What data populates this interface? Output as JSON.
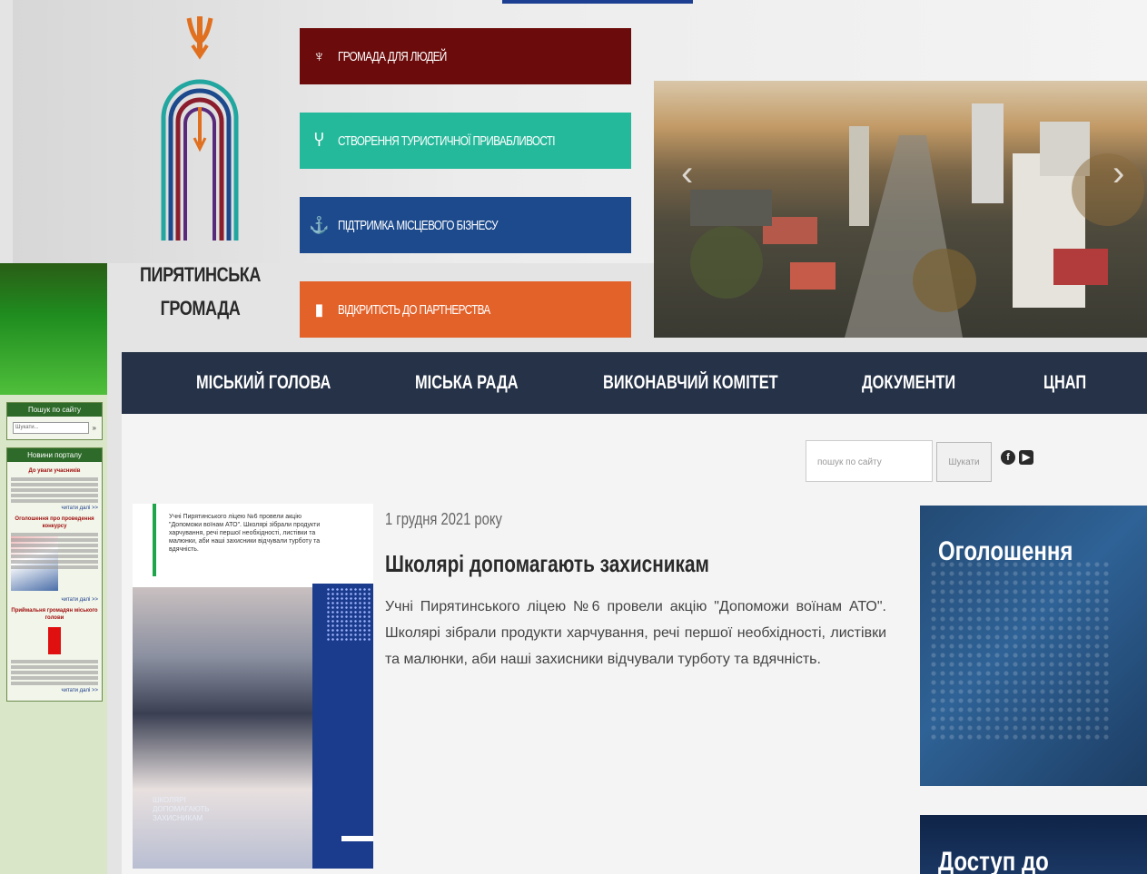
{
  "old_site": {
    "search_title": "Пошук по сайту",
    "search_placeholder": "Шукати...",
    "search_go": "»",
    "news_title": "Новини порталу",
    "news_items": [
      {
        "headline": "До уваги учасників",
        "more": "читати далі >>"
      },
      {
        "headline": "Оголошення про проведення конкурсу",
        "more": "читати далі >>"
      },
      {
        "headline": "Приймальня громадян міського голови",
        "more": "читати далі >>"
      }
    ]
  },
  "logo": {
    "line1": "ПИРЯТИНСЬКА",
    "line2": "ГРОМАДА"
  },
  "priorities": [
    {
      "label": "ГРОМАДА ДЛЯ ЛЮДЕЙ",
      "color": "#6b0b0b"
    },
    {
      "label": "СТВОРЕННЯ ТУРИСТИЧНОЇ ПРИВАБЛИВОСТІ",
      "color": "#25b99b"
    },
    {
      "label": "ПІДТРИМКА МІСЦЕВОГО БІЗНЕСУ",
      "color": "#1c4a8c"
    },
    {
      "label": "ВІДКРИТІСТЬ ДО ПАРТНЕРСТВА",
      "color": "#e3622a"
    }
  ],
  "slider": {
    "prev": "‹",
    "next": "›"
  },
  "nav": [
    "МІСЬКИЙ ГОЛОВА",
    "МІСЬКА РАДА",
    "ВИКОНАВЧИЙ КОМІТЕТ",
    "ДОКУМЕНТИ",
    "ЦНАП"
  ],
  "search": {
    "placeholder": "пошук по сайту",
    "button": "Шукати"
  },
  "social": {
    "facebook": "f",
    "youtube": "▶"
  },
  "news": {
    "image_caption": "Учні Пирятинського ліцею №6 провели акцію \"Допоможи воїнам АТО\". Школярі зібрали продукти харчування, речі першої необхідності, листівки та малюнки, аби наші захисники відчували турботу та вдячність.",
    "image_overlay": [
      "ШКОЛЯРІ",
      "ДОПОМАГАЮТЬ",
      "ЗАХИСНИКАМ"
    ],
    "date": "1 грудня 2021 року",
    "title": "Школярі допомагають захисникам",
    "text": "Учні Пирятинського ліцею №6 провели акцію \"Допоможи воїнам АТО\". Школярі зібрали продукти харчування, речі першої необхідності, листівки та малюнки, аби наші захисники відчували турботу та вдячність."
  },
  "sidebar_cards": [
    "Оголошення",
    "Доступ до"
  ]
}
